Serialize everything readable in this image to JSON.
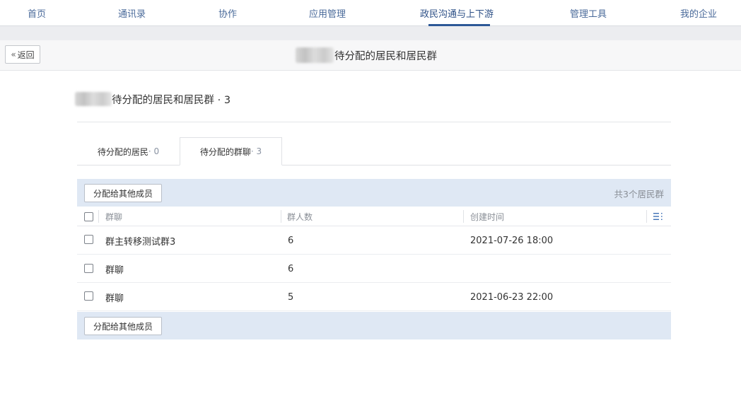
{
  "nav": {
    "items": [
      {
        "label": "首页"
      },
      {
        "label": "通讯录"
      },
      {
        "label": "协作"
      },
      {
        "label": "应用管理"
      },
      {
        "label": "政民沟通与上下游"
      },
      {
        "label": "管理工具"
      },
      {
        "label": "我的企业"
      }
    ],
    "active_index": 4
  },
  "titlebar": {
    "back_label": "返回",
    "title": "待分配的居民和居民群"
  },
  "heading": {
    "text": "待分配的居民和居民群 · 3"
  },
  "tabs": [
    {
      "label": "待分配的居民",
      "count": " · 0"
    },
    {
      "label": "待分配的群聊",
      "count": " · 3"
    }
  ],
  "active_tab": 1,
  "toolbar": {
    "assign_label": "分配给其他成员",
    "total_text": "共3个居民群"
  },
  "table": {
    "headers": {
      "name": "群聊",
      "members": "群人数",
      "created": "创建时间"
    },
    "rows": [
      {
        "name": "群主转移测试群3",
        "members": "6",
        "created": "2021-07-26 18:00"
      },
      {
        "name": "群聊",
        "members": "6",
        "created": ""
      },
      {
        "name": "群聊",
        "members": "5",
        "created": "2021-06-23 22:00"
      }
    ]
  },
  "colors": {
    "accent": "#2c5897",
    "toolbar_bg": "#dfe8f4",
    "nav_text": "#4a6a9a"
  }
}
